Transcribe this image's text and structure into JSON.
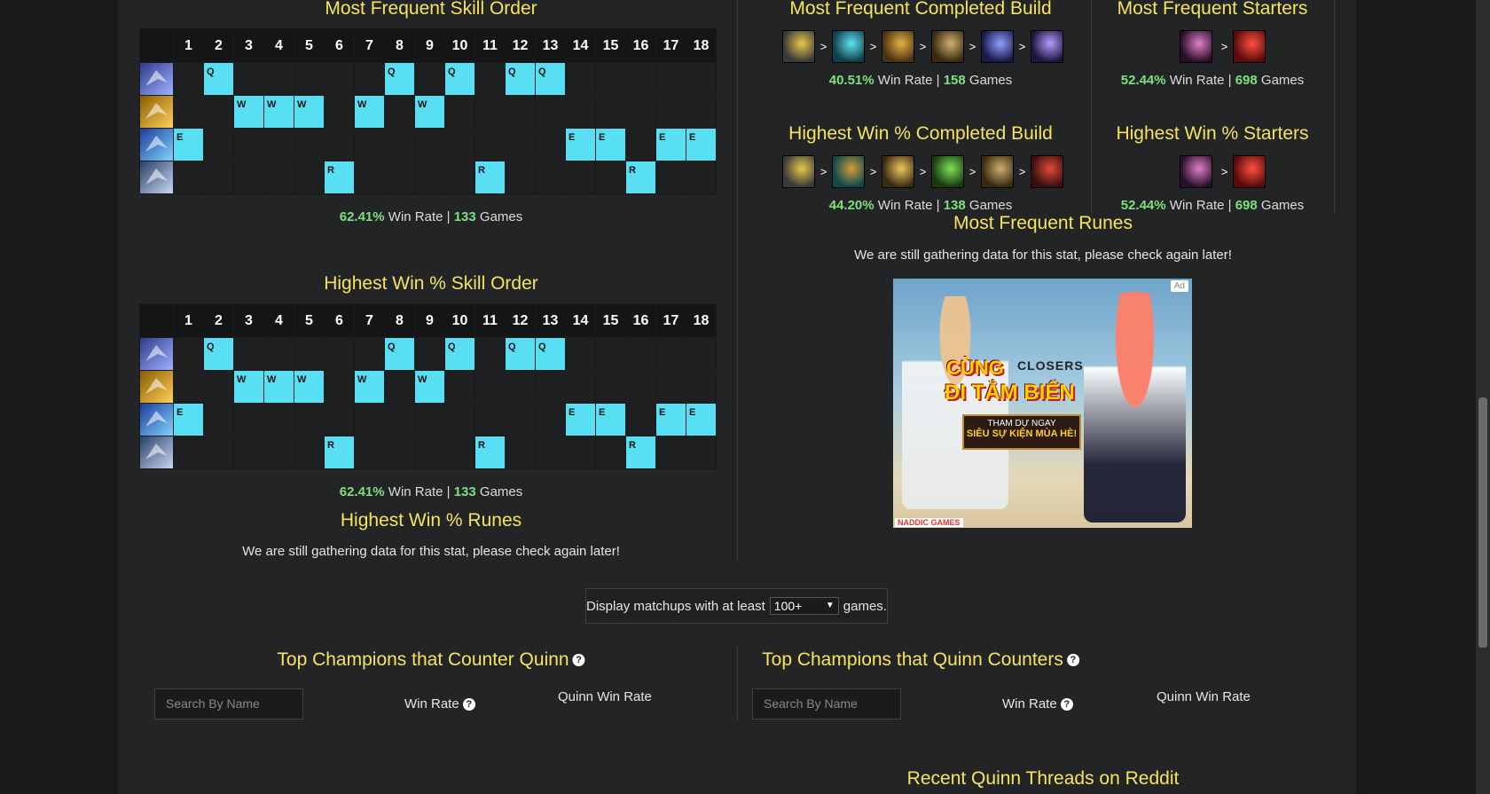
{
  "skill_levels": [
    "1",
    "2",
    "3",
    "4",
    "5",
    "6",
    "7",
    "8",
    "9",
    "10",
    "11",
    "12",
    "13",
    "14",
    "15",
    "16",
    "17",
    "18"
  ],
  "skill_rows": [
    {
      "icon": "quinn-q-ability-icon",
      "key": "Q",
      "levels": [
        2,
        8,
        10,
        12,
        13
      ],
      "c1": "#2e3a8a",
      "c2": "#9fb2ff"
    },
    {
      "icon": "quinn-w-ability-icon",
      "key": "W",
      "levels": [
        3,
        4,
        5,
        7,
        9
      ],
      "c1": "#8a5a00",
      "c2": "#ffd25a"
    },
    {
      "icon": "quinn-e-ability-icon",
      "key": "E",
      "levels": [
        1,
        14,
        15,
        17,
        18
      ],
      "c1": "#1f3a9a",
      "c2": "#7fd4ff"
    },
    {
      "icon": "quinn-r-ability-icon",
      "key": "R",
      "levels": [
        6,
        11,
        16
      ],
      "c1": "#2a3f6a",
      "c2": "#c8d7f0"
    }
  ],
  "freq_skill": {
    "title": "Most Frequent Skill Order",
    "win_rate": "62.41%",
    "win_label": " Win Rate | ",
    "games": "133",
    "games_label": " Games"
  },
  "high_skill": {
    "title": "Highest Win % Skill Order",
    "win_rate": "62.41%",
    "win_label": " Win Rate | ",
    "games": "133",
    "games_label": " Games"
  },
  "high_runes": {
    "title": "Highest Win % Runes",
    "message": "We are still gathering data for this stat, please check again later!"
  },
  "freq_build": {
    "title": "Most Frequent Completed Build",
    "win_rate": "40.51%",
    "win_label": " Win Rate | ",
    "games": "158",
    "games_label": " Games",
    "items": [
      {
        "icon": "item-icon",
        "c1": "#3a3a3a",
        "c2": "#e8c84a"
      },
      {
        "icon": "item-icon",
        "c1": "#0f3f4a",
        "c2": "#5fe3ef"
      },
      {
        "icon": "item-icon",
        "c1": "#4a3410",
        "c2": "#e7b14a"
      },
      {
        "icon": "item-icon",
        "c1": "#3a2a10",
        "c2": "#cfb070"
      },
      {
        "icon": "item-icon",
        "c1": "#1a1a4a",
        "c2": "#8fa0ff"
      },
      {
        "icon": "item-icon",
        "c1": "#1f1540",
        "c2": "#b69cff"
      }
    ]
  },
  "freq_starters": {
    "title": "Most Frequent Starters",
    "win_rate": "52.44%",
    "win_label": " Win Rate | ",
    "games": "698",
    "games_label": " Games",
    "items": [
      {
        "icon": "item-icon",
        "c1": "#2a0f2a",
        "c2": "#e080c8"
      },
      {
        "icon": "item-icon",
        "c1": "#5a0a0a",
        "c2": "#ff5040"
      }
    ]
  },
  "high_build": {
    "title": "Highest Win % Completed Build",
    "win_rate": "44.20%",
    "win_label": " Win Rate | ",
    "games": "138",
    "games_label": " Games",
    "items": [
      {
        "icon": "item-icon",
        "c1": "#3a3a3a",
        "c2": "#e8c84a"
      },
      {
        "icon": "item-icon",
        "c1": "#0f4a4a",
        "c2": "#d39a3a"
      },
      {
        "icon": "item-icon",
        "c1": "#3a2a10",
        "c2": "#f0c860"
      },
      {
        "icon": "item-icon",
        "c1": "#1a3a10",
        "c2": "#7fe05a"
      },
      {
        "icon": "item-icon",
        "c1": "#3a2a10",
        "c2": "#cfb070"
      },
      {
        "icon": "item-icon",
        "c1": "#3a0f0f",
        "c2": "#e04a3a"
      }
    ]
  },
  "high_starters": {
    "title": "Highest Win % Starters",
    "win_rate": "52.44%",
    "win_label": " Win Rate | ",
    "games": "698",
    "games_label": " Games",
    "items": [
      {
        "icon": "item-icon",
        "c1": "#2a0f2a",
        "c2": "#e080c8"
      },
      {
        "icon": "item-icon",
        "c1": "#5a0a0a",
        "c2": "#ff5040"
      }
    ]
  },
  "freq_runes": {
    "title": "Most Frequent Runes",
    "message": "We are still gathering data for this stat, please check again later!"
  },
  "ad": {
    "badge": "Ad",
    "line1": "CÙNG",
    "logo": "CLOSERS",
    "line2": "ĐI TẮM BIỂN",
    "banner1": "THAM DỰ NGAY",
    "banner2": "SIÊU SỰ KIỆN MÙA HÈ!",
    "footer": "NADDIC GAMES"
  },
  "filter": {
    "prefix": "Display matchups with at least",
    "value": "100+",
    "suffix": "games."
  },
  "counters": {
    "title": "Top Champions that Counter Quinn",
    "search_placeholder": "Search By Name",
    "col_win": "Win Rate",
    "col_champ": "Quinn Win Rate"
  },
  "countered": {
    "title": "Top Champions that Quinn Counters",
    "search_placeholder": "Search By Name",
    "col_win": "Win Rate",
    "col_champ": "Quinn Win Rate"
  },
  "reddit": {
    "title": "Recent Quinn Threads on Reddit"
  },
  "colors": {
    "accent_title": "#f7e35c",
    "skill_fill": "#59dff4",
    "stat_green": "#7de07d"
  }
}
